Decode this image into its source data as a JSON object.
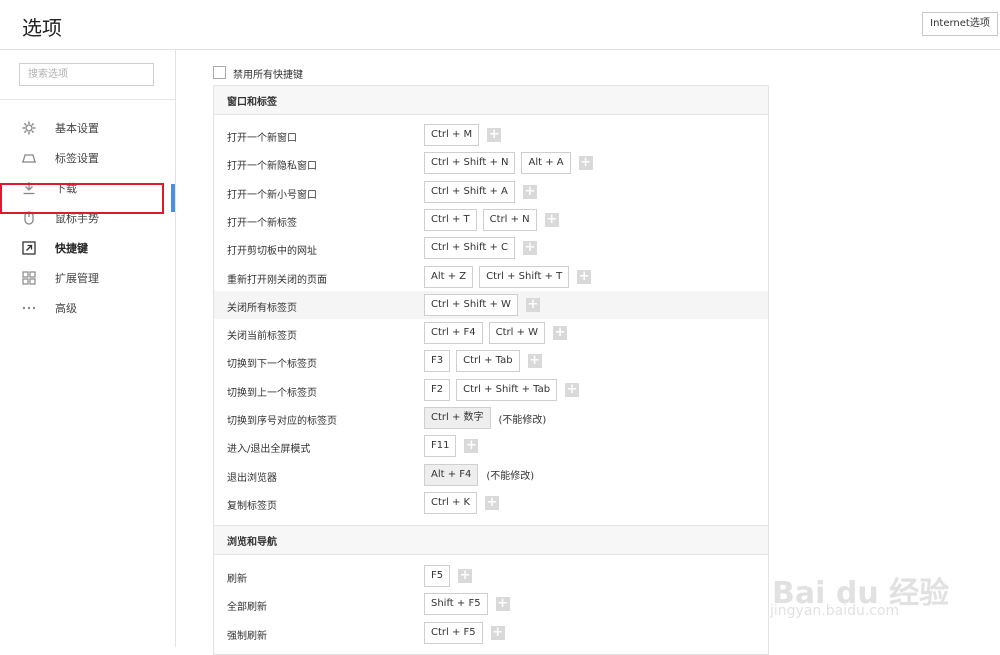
{
  "header": {
    "title": "选项",
    "internet_button": "Internet选项"
  },
  "sidebar": {
    "search_placeholder": "搜索选项",
    "items": [
      {
        "label": "基本设置",
        "icon": "gear-icon"
      },
      {
        "label": "标签设置",
        "icon": "tab-icon"
      },
      {
        "label": "下载",
        "icon": "download-icon"
      },
      {
        "label": "鼠标手势",
        "icon": "mouse-icon"
      },
      {
        "label": "快捷键",
        "icon": "shortcut-icon",
        "active": true
      },
      {
        "label": "扩展管理",
        "icon": "extensions-icon"
      },
      {
        "label": "高级",
        "icon": "more-icon"
      }
    ]
  },
  "main": {
    "disable_label": "禁用所有快捷键",
    "sections": [
      {
        "title": "窗口和标签",
        "rows": [
          {
            "label": "打开一个新窗口",
            "keys": [
              "Ctrl + M"
            ]
          },
          {
            "label": "打开一个新隐私窗口",
            "keys": [
              "Ctrl + Shift + N",
              "Alt + A"
            ]
          },
          {
            "label": "打开一个新小号窗口",
            "keys": [
              "Ctrl + Shift + A"
            ]
          },
          {
            "label": "打开一个新标签",
            "keys": [
              "Ctrl + T",
              "Ctrl + N"
            ]
          },
          {
            "label": "打开剪切板中的网址",
            "keys": [
              "Ctrl + Shift + C"
            ]
          },
          {
            "label": "重新打开刚关闭的页面",
            "keys": [
              "Alt + Z",
              "Ctrl + Shift + T"
            ]
          },
          {
            "label": "关闭所有标签页",
            "keys": [
              "Ctrl + Shift + W"
            ]
          },
          {
            "label": "关闭当前标签页",
            "keys": [
              "Ctrl + F4",
              "Ctrl + W"
            ]
          },
          {
            "label": "切换到下一个标签页",
            "keys": [
              "F3",
              "Ctrl + Tab"
            ]
          },
          {
            "label": "切换到上一个标签页",
            "keys": [
              "F2",
              "Ctrl + Shift + Tab"
            ]
          },
          {
            "label": "切换到序号对应的标签页",
            "keys": [
              "Ctrl + 数字"
            ],
            "note": "(不能修改)"
          },
          {
            "label": "进入/退出全屏模式",
            "keys": [
              "F11"
            ]
          },
          {
            "label": "退出浏览器",
            "keys": [
              "Alt + F4"
            ],
            "note": "(不能修改)"
          },
          {
            "label": "复制标签页",
            "keys": [
              "Ctrl + K"
            ]
          }
        ]
      },
      {
        "title": "浏览和导航",
        "rows": [
          {
            "label": "刷新",
            "keys": [
              "F5"
            ]
          },
          {
            "label": "全部刷新",
            "keys": [
              "Shift + F5"
            ]
          },
          {
            "label": "强制刷新",
            "keys": [
              "Ctrl + F5"
            ]
          }
        ]
      }
    ]
  },
  "watermark": {
    "brand": "Bai du 经验",
    "url": "jingyan.baidu.com"
  },
  "colors": {
    "highlight_border": "#e0192b",
    "active_bar": "#4a90e2",
    "plus_button": "#d9d9d9"
  }
}
